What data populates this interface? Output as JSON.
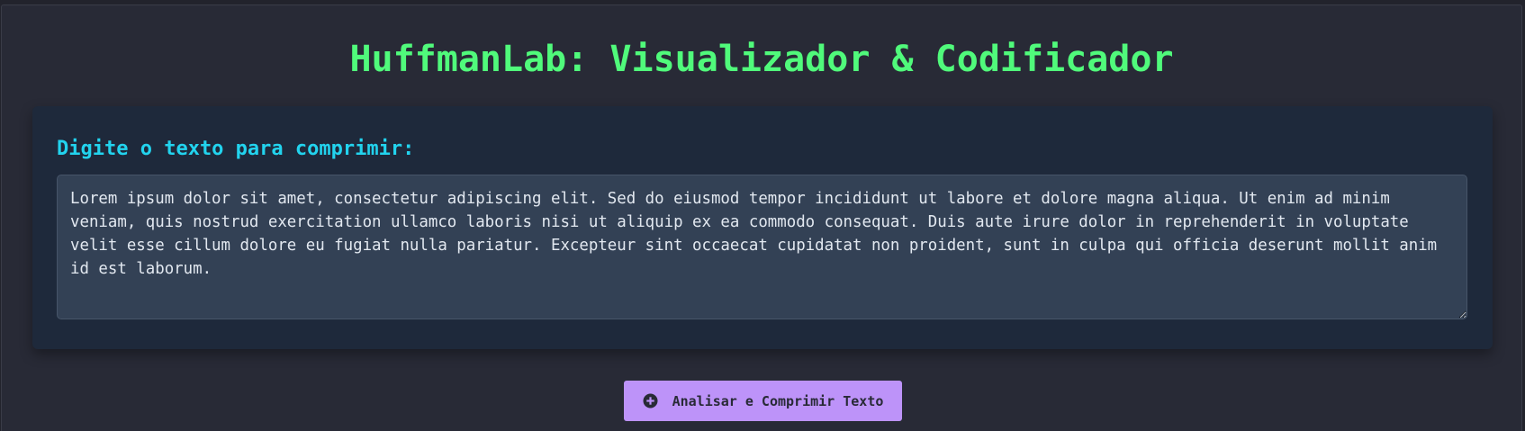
{
  "header": {
    "title": "HuffmanLab: Visualizador & Codificador"
  },
  "input": {
    "label": "Digite o texto para comprimir:",
    "value": "Lorem ipsum dolor sit amet, consectetur adipiscing elit. Sed do eiusmod tempor incididunt ut labore et dolore magna aliqua. Ut enim ad minim veniam, quis nostrud exercitation ullamco laboris nisi ut aliquip ex ea commodo consequat. Duis aute irure dolor in reprehenderit in voluptate velit esse cillum dolore eu fugiat nulla pariatur. Excepteur sint occaecat cupidatat non proident, sunt in culpa qui officia deserunt mollit anim id est laborum."
  },
  "actions": {
    "analyze_label": "Analisar e Comprimir Texto",
    "analyze_icon": "plus-circle-icon"
  },
  "colors": {
    "page_background": "#282a36",
    "title": "#50fa7b",
    "label": "#22d3ee",
    "card": "#1e293b",
    "textarea": "#334155",
    "button": "#bd93f9"
  }
}
